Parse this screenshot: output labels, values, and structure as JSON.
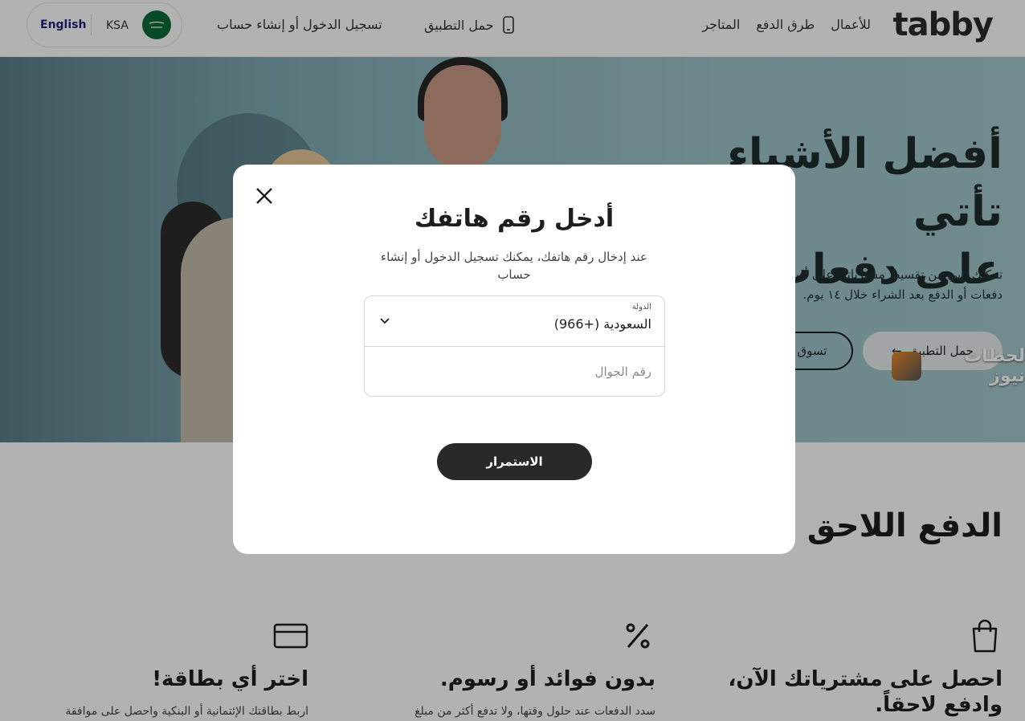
{
  "header": {
    "logo": "tabby",
    "nav": [
      "المتاجر",
      "طرق الدفع",
      "للأعمال"
    ],
    "download_app": "حمل التطبيق",
    "login": "تسجيل الدخول أو إنشاء حساب",
    "language": "English",
    "region": "KSA"
  },
  "hero": {
    "title_line1": "أفضل الأشياء تأتي",
    "title_line2": "على دفعات",
    "subtitle": "تمكنك تابي من تقسيط مشترياتك على أربع دفعات أو الدفع بعد الشراء خلال ١٤ يوم.",
    "btn_download": "حمل التطبيق",
    "btn_shop": "تسوق",
    "watermark": "لحظات نيوز"
  },
  "section": {
    "title": "الدفع اللاحق مع تابي",
    "features": [
      {
        "icon": "shopping-bag-icon",
        "title_line1": "احصل على مشترياتك الآن،",
        "title_line2": "وادفع لاحقاً.",
        "desc": ""
      },
      {
        "icon": "percent-icon",
        "title_line1": "بدون فوائد أو رسوم.",
        "title_line2": "",
        "desc": "سدد الدفعات عند حلول وقتها، ولا تدفع أكثر من مبلغ"
      },
      {
        "icon": "credit-card-icon",
        "title_line1": "اختر أي بطاقة!",
        "title_line2": "",
        "desc": "اربط بطاقتك الإئتمانية أو البنكية واحصل على موافقة"
      }
    ]
  },
  "modal": {
    "title": "أدخل رقم هاتفك",
    "subtitle": "عند إدخال رقم هاتفك، يمكنك تسجيل الدخول أو إنشاء حساب",
    "country_label": "الدولة",
    "country_value": "السعودية (+966)",
    "phone_placeholder": "رقم الجوال",
    "continue": "الاستمرار"
  },
  "colors": {
    "primary_button": "#292929",
    "language_link": "#1a237e",
    "flag_green": "#0b6b3a"
  }
}
